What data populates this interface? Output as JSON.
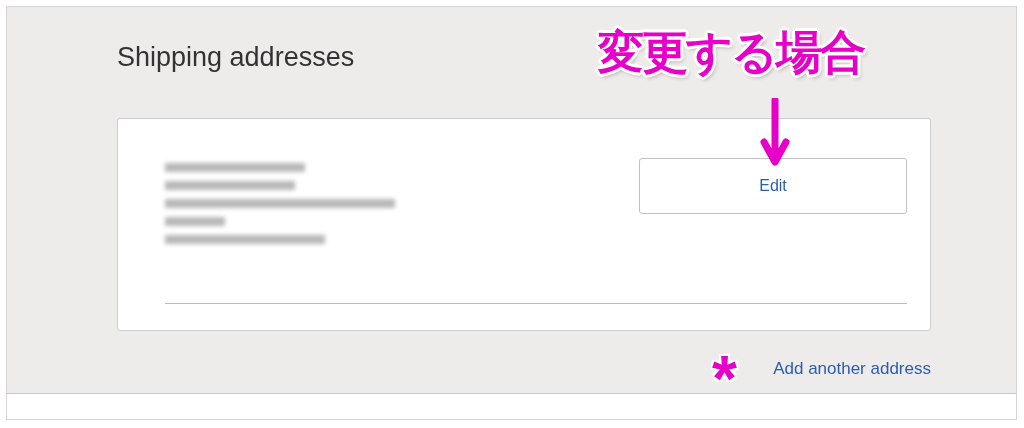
{
  "page": {
    "title": "Shipping addresses"
  },
  "address_card": {
    "edit_button": "Edit"
  },
  "add_link": "Add another address",
  "annotation": {
    "label": "変更する場合",
    "marker": "*"
  }
}
